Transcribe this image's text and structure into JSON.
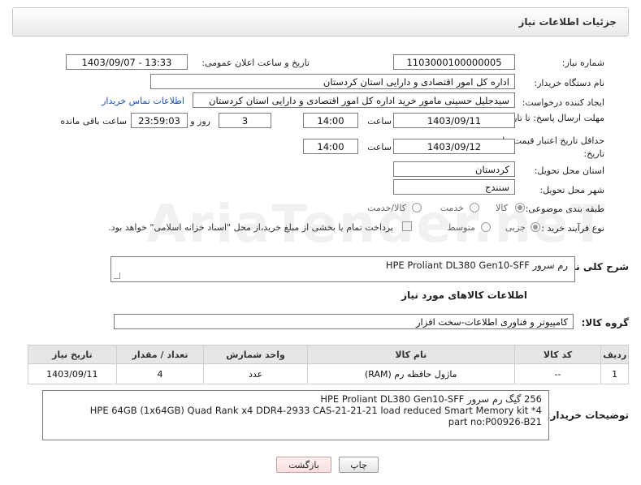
{
  "header": {
    "title": "جزئیات اطلاعات نیاز"
  },
  "form": {
    "need_number_label": "شماره نیاز:",
    "need_number": "1103000100000005",
    "announce_label": "تاریخ و ساعت اعلان عمومی:",
    "announce_value": "1403/09/07 - 13:33",
    "buyer_org_label": "نام دستگاه خریدار:",
    "buyer_org": "اداره کل امور اقتصادی و دارایی استان کردستان",
    "requester_label": "ایجاد کننده درخواست:",
    "requester": "سیدجلیل حسینی مامور خرید اداره کل امور اقتصادی و دارایی استان کردستان",
    "contact_link": "اطلاعات تماس خریدار",
    "reply_deadline_label": "مهلت ارسال پاسخ: تا تاریخ:",
    "reply_date": "1403/09/11",
    "time_label": "ساعت",
    "reply_time": "14:00",
    "days_value": "3",
    "days_label": "روز و",
    "remaining_time": "23:59:03",
    "remaining_label": "ساعت باقی مانده",
    "validity_label": "حداقل تاریخ اعتبار قیمت: تا تاریخ:",
    "validity_date": "1403/09/12",
    "validity_time": "14:00",
    "province_label": "استان محل تحویل:",
    "province": "کردستان",
    "city_label": "شهر محل تحویل:",
    "city": "سنندج",
    "category_label": "طبقه بندی موضوعی:",
    "category_options": [
      "کالا",
      "خدمت",
      "کالا/خدمت"
    ],
    "process_label": "نوع فرآیند خرید :",
    "process_options": [
      "جزیی",
      "متوسط"
    ],
    "payment_note": "پرداخت تمام یا بخشی از مبلغ خرید،از محل \"اسناد خزانه اسلامی\" خواهد بود."
  },
  "summary": {
    "label": "شرح کلی نیاز:",
    "value": "رم سرور  HPE Proliant DL380 Gen10-SFF"
  },
  "goods_section_title": "اطلاعات کالاهای مورد نیاز",
  "goods_group": {
    "label": "گروه کالا:",
    "value": "کامپیوتر و فناوری اطلاعات-سخت افزار"
  },
  "table": {
    "headers": [
      "ردیف",
      "کد کالا",
      "نام کالا",
      "واحد شمارش",
      "تعداد / مقدار",
      "تاریخ نیاز"
    ],
    "rows": [
      [
        "1",
        "--",
        "ماژول حافظه رم (RAM)",
        "عدد",
        "4",
        "1403/09/11"
      ]
    ]
  },
  "buyer_description": {
    "label": "توضیحات خریدار:",
    "lines": [
      "256 گیگ رم سرور  HPE Proliant DL380 Gen10-SFF",
      "HPE 64GB (1x64GB) Quad Rank x4 DDR4-2933 CAS-21-21-21 load reduced Smart Memory kit *4",
      "part no:P00926-B21"
    ]
  },
  "buttons": {
    "print": "چاپ",
    "back": "بازگشت"
  },
  "watermark": "AriaTender.neT"
}
